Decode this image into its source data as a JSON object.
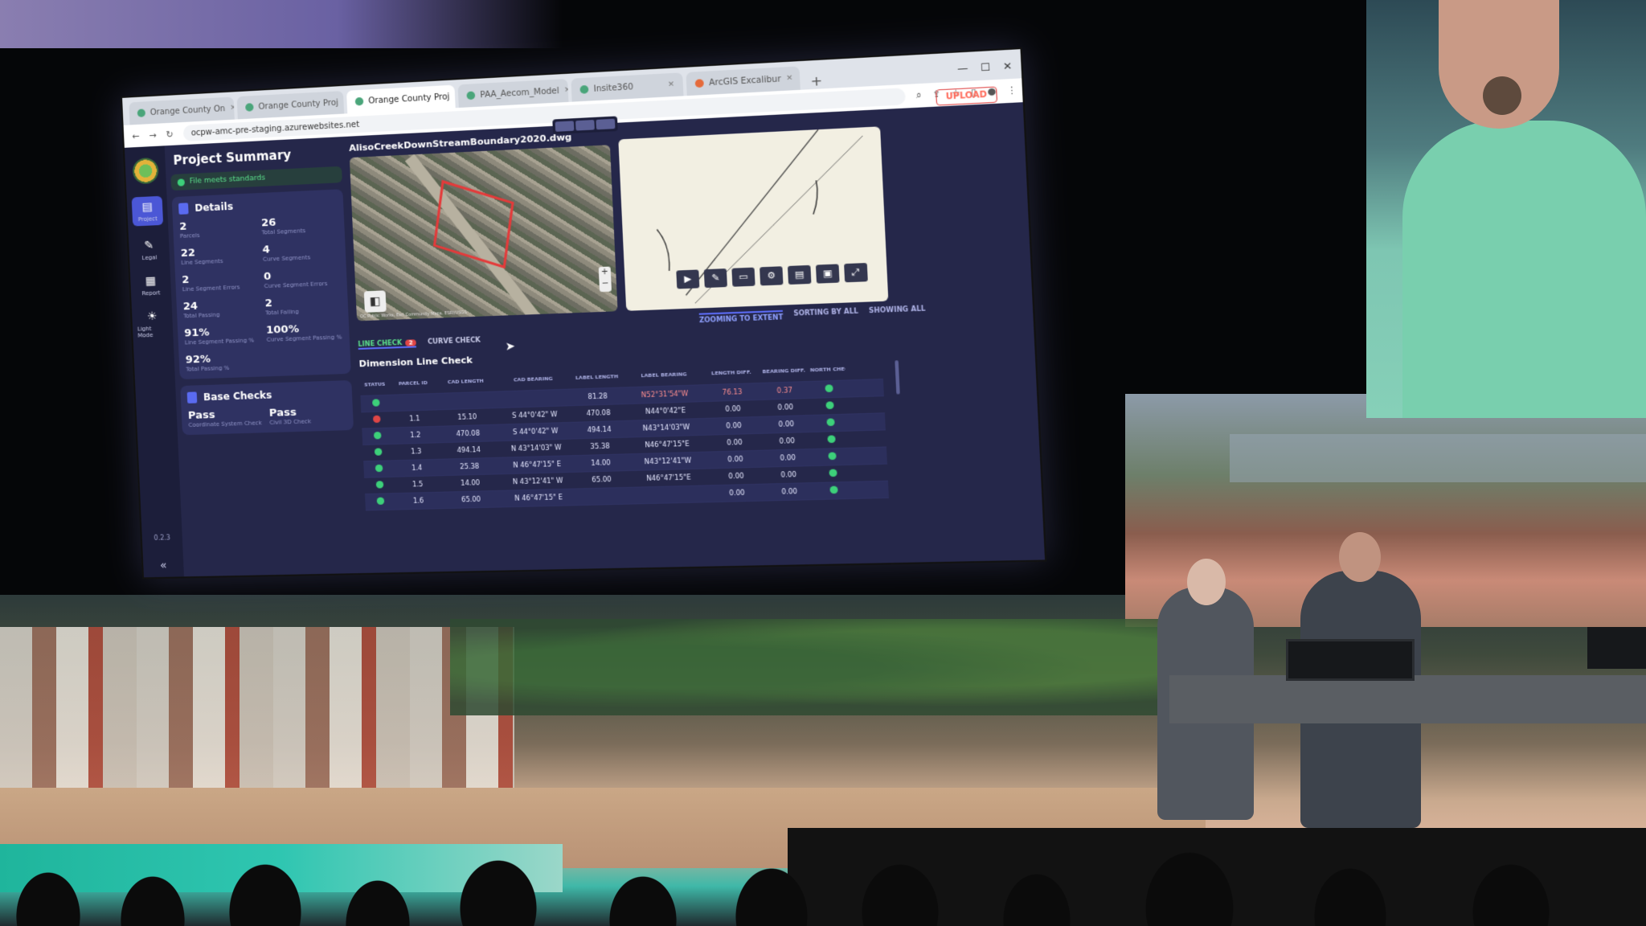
{
  "browser": {
    "tabs": [
      {
        "label": "Orange County On",
        "active": false
      },
      {
        "label": "Orange County Proj",
        "active": false
      },
      {
        "label": "Orange County Proj",
        "active": true
      },
      {
        "label": "PAA_Aecom_Model",
        "active": false
      },
      {
        "label": "Insite360",
        "active": false
      },
      {
        "label": "ArcGIS Excalibur",
        "active": false
      }
    ],
    "url": "ocpw-amc-pre-staging.azurewebsites.net"
  },
  "rail": {
    "items": [
      {
        "label": "Project",
        "icon": "document-icon"
      },
      {
        "label": "Legal",
        "icon": "pen-icon"
      },
      {
        "label": "Report",
        "icon": "report-icon"
      },
      {
        "label": "Light Mode",
        "icon": "sun-icon"
      }
    ],
    "version": "0.2.3"
  },
  "summary": {
    "title": "Project Summary",
    "banner": "File meets standards",
    "details_title": "Details",
    "stats": [
      {
        "value": "2",
        "label": "Parcels"
      },
      {
        "value": "26",
        "label": "Total Segments"
      },
      {
        "value": "22",
        "label": "Line Segments"
      },
      {
        "value": "4",
        "label": "Curve Segments"
      },
      {
        "value": "2",
        "label": "Line Segment Errors"
      },
      {
        "value": "0",
        "label": "Curve Segment Errors"
      },
      {
        "value": "24",
        "label": "Total Passing"
      },
      {
        "value": "2",
        "label": "Total Failing"
      },
      {
        "value": "91%",
        "label": "Line Segment Passing %"
      },
      {
        "value": "100%",
        "label": "Curve Segment Passing %"
      },
      {
        "value": "92%",
        "label": "Total Passing %"
      }
    ],
    "base_title": "Base Checks",
    "base": [
      {
        "value": "Pass",
        "label": "Coordinate System Check"
      },
      {
        "value": "Pass",
        "label": "Civil 3D Check"
      }
    ]
  },
  "main": {
    "filename": "AlisoCreekDownStreamBoundary2020.dwg",
    "upload": "UPLOAD",
    "map_attribution": "OC Public Works, Esri Community Maps, ESRI/USGS",
    "status": [
      "ZOOMING TO EXTENT",
      "SORTING BY ALL",
      "SHOWING ALL"
    ],
    "tab_line": "LINE CHECK",
    "tab_line_badge": "2",
    "tab_curve": "CURVE CHECK",
    "table_title": "Dimension Line Check",
    "columns": [
      "STATUS",
      "PARCEL ID",
      "CAD LENGTH",
      "CAD BEARING",
      "LABEL LENGTH",
      "LABEL BEARING",
      "LENGTH DIFF.",
      "BEARING DIFF.",
      "NORTH CHECK"
    ],
    "rows": [
      {
        "status": "ok",
        "id": "",
        "cad_len": "",
        "cad_bear": "",
        "lbl_len": "81.28",
        "lbl_bear": "N52°31'54\"W",
        "len_diff": "76.13",
        "bear_diff": "0.37",
        "north": "ok",
        "error": true
      },
      {
        "status": "err",
        "id": "1.1",
        "cad_len": "15.10",
        "cad_bear": "S 44°0'42\" W",
        "lbl_len": "470.08",
        "lbl_bear": "N44°0'42\"E",
        "len_diff": "0.00",
        "bear_diff": "0.00",
        "north": "ok",
        "error": false
      },
      {
        "status": "ok",
        "id": "1.2",
        "cad_len": "470.08",
        "cad_bear": "S 44°0'42\" W",
        "lbl_len": "494.14",
        "lbl_bear": "N43°14'03\"W",
        "len_diff": "0.00",
        "bear_diff": "0.00",
        "north": "ok",
        "error": false
      },
      {
        "status": "ok",
        "id": "1.3",
        "cad_len": "494.14",
        "cad_bear": "N 43°14'03\" W",
        "lbl_len": "35.38",
        "lbl_bear": "N46°47'15\"E",
        "len_diff": "0.00",
        "bear_diff": "0.00",
        "north": "ok",
        "error": false
      },
      {
        "status": "ok",
        "id": "1.4",
        "cad_len": "25.38",
        "cad_bear": "N 46°47'15\" E",
        "lbl_len": "14.00",
        "lbl_bear": "N43°12'41\"W",
        "len_diff": "0.00",
        "bear_diff": "0.00",
        "north": "ok",
        "error": false
      },
      {
        "status": "ok",
        "id": "1.5",
        "cad_len": "14.00",
        "cad_bear": "N 43°12'41\" W",
        "lbl_len": "65.00",
        "lbl_bear": "N46°47'15\"E",
        "len_diff": "0.00",
        "bear_diff": "0.00",
        "north": "ok",
        "error": false
      },
      {
        "status": "ok",
        "id": "1.6",
        "cad_len": "65.00",
        "cad_bear": "N 46°47'15\" E",
        "lbl_len": "",
        "lbl_bear": "",
        "len_diff": "0.00",
        "bear_diff": "0.00",
        "north": "ok",
        "error": false
      }
    ]
  },
  "colors": {
    "accent": "#5b6bf5",
    "pass": "#3dd07a",
    "fail": "#e04646",
    "panel": "#2f3262"
  }
}
